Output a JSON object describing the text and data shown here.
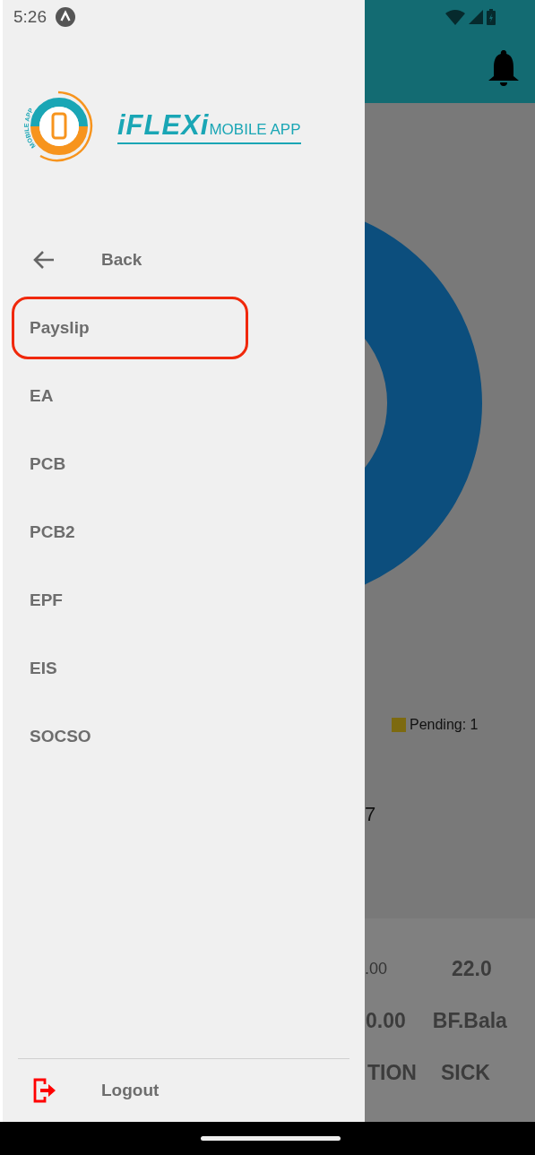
{
  "status_bar": {
    "time": "5:26"
  },
  "drawer": {
    "logo": {
      "ring_text": "MOBILE APP",
      "brand": "iFLEXi",
      "tagline": "MOBILE APP"
    },
    "back": {
      "label": "Back"
    },
    "items": [
      {
        "label": "Payslip",
        "selected": true
      },
      {
        "label": "EA",
        "selected": false
      },
      {
        "label": "PCB",
        "selected": false
      },
      {
        "label": "PCB2",
        "selected": false
      },
      {
        "label": "EPF",
        "selected": false
      },
      {
        "label": "EIS",
        "selected": false
      },
      {
        "label": "SOCSO",
        "selected": false
      }
    ],
    "logout": {
      "label": "Logout"
    }
  },
  "background": {
    "legend": [
      {
        "label": "Pending: 1",
        "color": "#7d6a10"
      }
    ],
    "count": "7",
    "summary": [
      {
        "cells": [
          {
            "text": ".00",
            "faded": true
          },
          {
            "text": "22.0",
            "faded": false
          }
        ]
      },
      {
        "cells": [
          {
            "text": "0.00",
            "faded": false
          },
          {
            "text": "BF.Bala",
            "faded": false
          }
        ]
      },
      {
        "cells": [
          {
            "text": "TION",
            "faded": false
          },
          {
            "text": "SICK",
            "faded": false
          }
        ]
      }
    ]
  }
}
